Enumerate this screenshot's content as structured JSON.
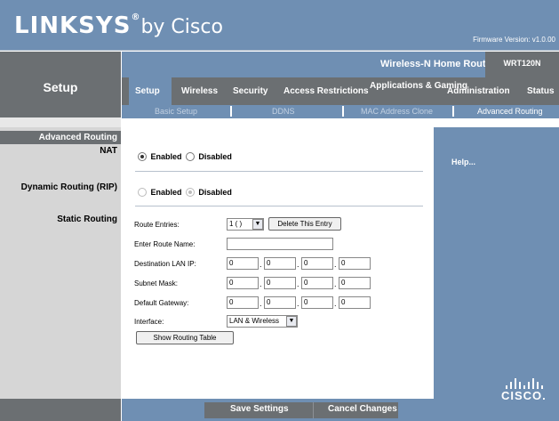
{
  "header": {
    "brand": "LINKSYS",
    "brand_suffix": "by Cisco",
    "firmware": "Firmware Version: v1.0.00"
  },
  "product": {
    "name": "Wireless-N Home Router",
    "model": "WRT120N"
  },
  "section": "Setup",
  "tabs": [
    {
      "label": "Setup"
    },
    {
      "label": "Wireless"
    },
    {
      "label": "Security"
    },
    {
      "label": "Access Restrictions"
    },
    {
      "label": "Applications & Gaming"
    },
    {
      "label": "Administration"
    },
    {
      "label": "Status"
    }
  ],
  "subtabs": [
    {
      "label": "Basic Setup"
    },
    {
      "label": "DDNS"
    },
    {
      "label": "MAC Address Clone"
    },
    {
      "label": "Advanced Routing"
    }
  ],
  "left_labels": {
    "advanced_routing": "Advanced Routing",
    "nat": "NAT",
    "dynamic_routing": "Dynamic Routing (RIP)",
    "static_routing": "Static Routing"
  },
  "nat": {
    "enabled": "Enabled",
    "disabled": "Disabled",
    "selected": "Enabled"
  },
  "rip": {
    "enabled": "Enabled",
    "disabled": "Disabled",
    "selected": "Disabled"
  },
  "static": {
    "route_entries_label": "Route Entries:",
    "route_entries_value": "1 ( )",
    "delete_entry": "Delete This Entry",
    "route_name_label": "Enter Route Name:",
    "route_name_value": "",
    "dest_lan_ip_label": "Destination LAN IP:",
    "dest_lan_ip": [
      "0",
      "0",
      "0",
      "0"
    ],
    "subnet_mask_label": "Subnet Mask:",
    "subnet_mask": [
      "0",
      "0",
      "0",
      "0"
    ],
    "gateway_label": "Default Gateway:",
    "gateway": [
      "0",
      "0",
      "0",
      "0"
    ],
    "interface_label": "Interface:",
    "interface_value": "LAN & Wireless",
    "show_table": "Show Routing Table"
  },
  "help": "Help...",
  "buttons": {
    "save": "Save Settings",
    "cancel": "Cancel Changes"
  },
  "footer_logo": "CISCO.",
  "colors": {
    "blue": "#6f8fb3",
    "gray": "#6b6f72",
    "light_gray": "#d6d6d6"
  }
}
